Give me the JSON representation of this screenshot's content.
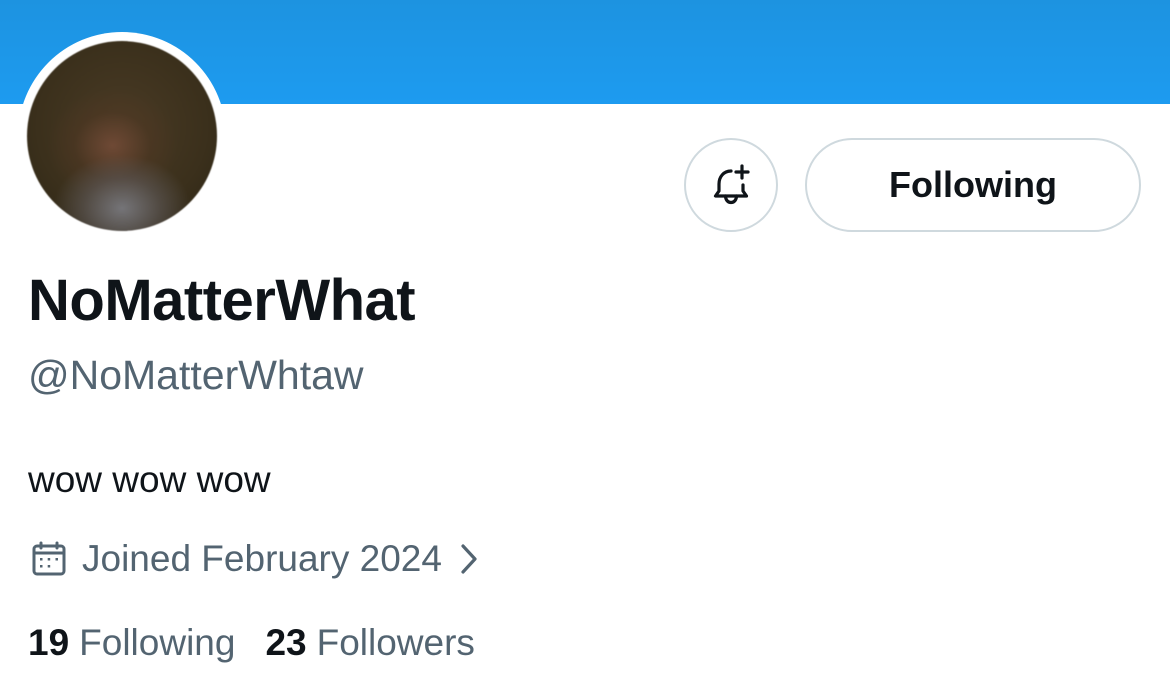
{
  "profile": {
    "display_name": "NoMatterWhat",
    "handle": "@NoMatterWhtaw",
    "bio": "wow wow wow",
    "joined": "Joined February 2024",
    "following_count": "19",
    "following_label": "Following",
    "followers_count": "23",
    "followers_label": "Followers"
  },
  "actions": {
    "follow_state_label": "Following",
    "notify_icon": "bell-plus-icon"
  },
  "icons": {
    "joined": "calendar-icon",
    "joined_more": "chevron-right-icon"
  },
  "colors": {
    "banner": "#1d9bf0",
    "primary_text": "#0f1419",
    "secondary_text": "#536471",
    "button_border": "#cfd9de"
  }
}
